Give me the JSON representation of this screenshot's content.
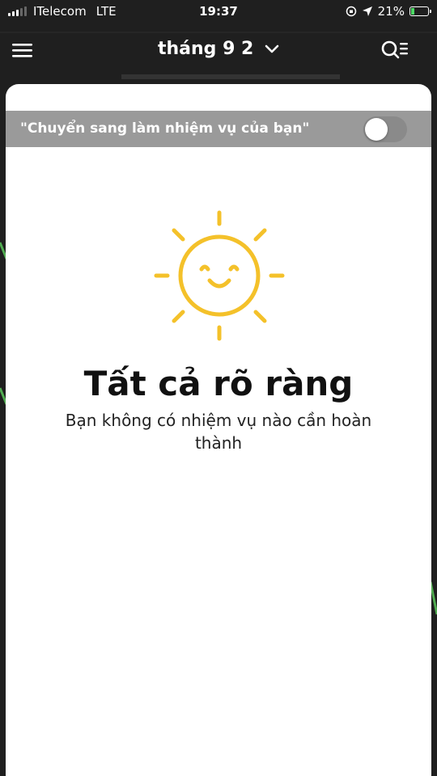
{
  "status_bar": {
    "carrier": "ITelecom",
    "network": "LTE",
    "time": "19:37",
    "battery_percent": "21%",
    "battery_level": 0.21,
    "icons": [
      "signal-icon",
      "orientation-lock-icon",
      "location-arrow-icon",
      "battery-charging-icon"
    ]
  },
  "header": {
    "month_label": "tháng 9 2",
    "menu_icon": "hamburger-menu-icon",
    "dropdown_icon": "chevron-down-icon",
    "search_icon": "search-list-icon"
  },
  "task_panel": {
    "toggle_label": "\"Chuyển sang làm nhiệm vụ của bạn\"",
    "toggle_on": false,
    "empty_title": "Tất cả rõ ràng",
    "empty_subtitle": "Bạn không có nhiệm vụ nào cần hoàn thành",
    "illustration": "smiling-sun-icon"
  },
  "colors": {
    "sun": "#F4C12A",
    "card_bg": "#FFFFFF",
    "toggle_bar": "#9A9A9A",
    "map_route": "#5ED05E"
  }
}
